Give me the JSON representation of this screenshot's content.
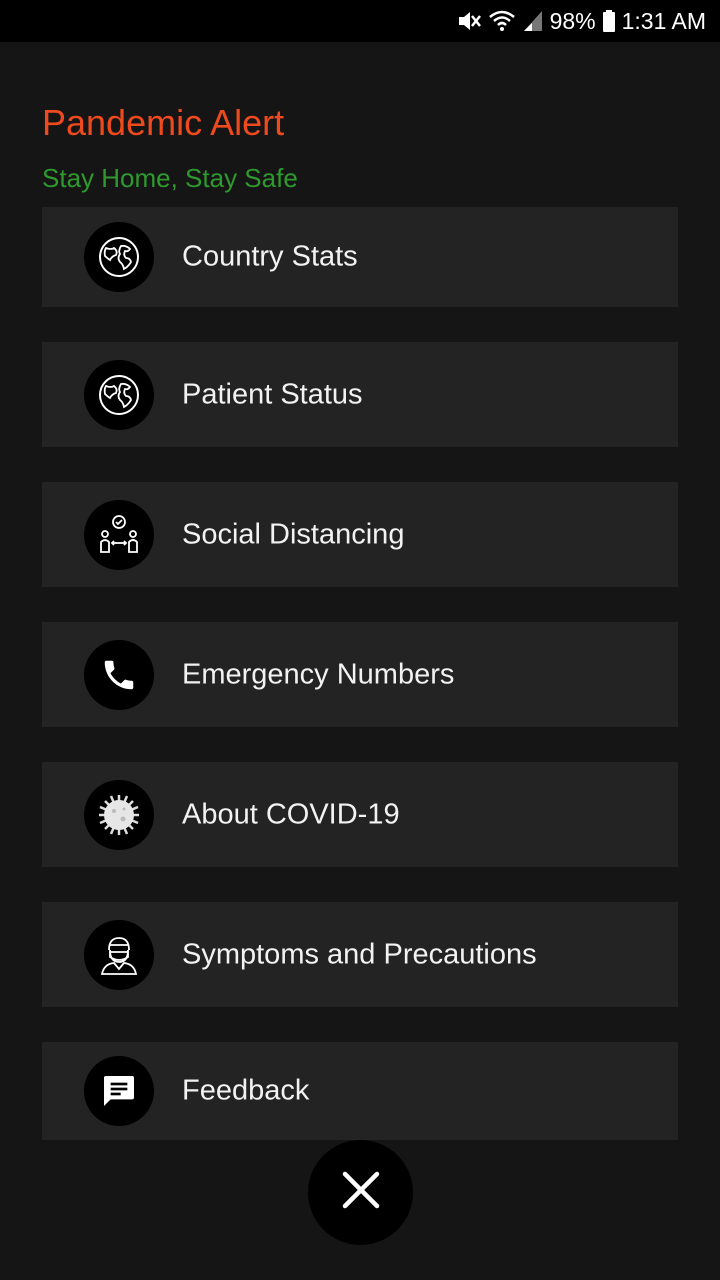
{
  "status_bar": {
    "battery": "98%",
    "time": "1:31 AM",
    "icons": [
      "mute-icon",
      "wifi-icon",
      "signal-icon",
      "battery-icon"
    ]
  },
  "header": {
    "title": "Pandemic Alert",
    "subtitle": "Stay Home, Stay Safe"
  },
  "menu": {
    "items": [
      {
        "label": "Country Stats",
        "icon": "globe-icon"
      },
      {
        "label": "Patient Status",
        "icon": "globe-icon"
      },
      {
        "label": "Social Distancing",
        "icon": "social-distancing-icon"
      },
      {
        "label": "Emergency Numbers",
        "icon": "phone-icon"
      },
      {
        "label": "About COVID-19",
        "icon": "virus-icon"
      },
      {
        "label": "Symptoms and Precautions",
        "icon": "masked-person-icon"
      },
      {
        "label": "Feedback",
        "icon": "feedback-icon"
      }
    ]
  },
  "close_button": {
    "icon": "close-icon"
  },
  "colors": {
    "title": "#ef4a1d",
    "subtitle": "#2e9a2e",
    "background": "#151515",
    "item_background": "#232323"
  }
}
